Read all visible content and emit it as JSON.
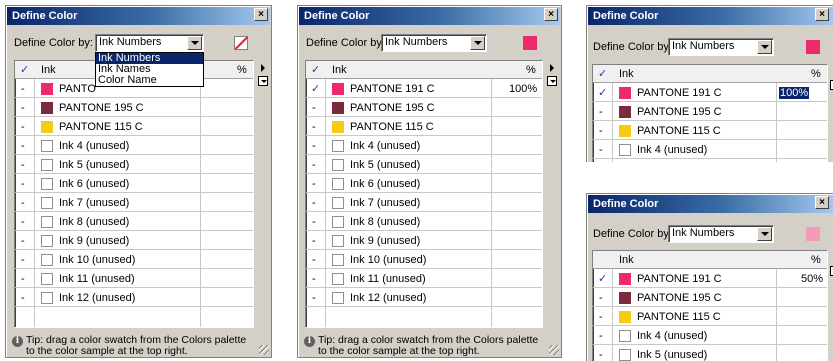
{
  "title": "Define Color",
  "close_glyph": "×",
  "define_label": "Define Color by:",
  "mode_value": "Ink Numbers",
  "dropdown_options": [
    "Ink Numbers",
    "Ink Names",
    "Color Name"
  ],
  "col_ink": "Ink",
  "col_pct": "%",
  "check_glyph": "✓",
  "dash": "-",
  "tip_line1": "Tip: drag a color swatch  from the Colors palette",
  "tip_line2": "to the color sample at the top right.",
  "info_glyph": "i",
  "inks": [
    {
      "name": "PANTONE 191 C",
      "color": "#ec2a6c"
    },
    {
      "name": "PANTONE 195 C",
      "color": "#7a2a3a"
    },
    {
      "name": "PANTONE 115 C",
      "color": "#f7cc10"
    },
    {
      "name": "Ink 4 (unused)",
      "color": "#ffffff"
    },
    {
      "name": "Ink 5 (unused)",
      "color": "#ffffff"
    },
    {
      "name": "Ink 6 (unused)",
      "color": "#ffffff"
    },
    {
      "name": "Ink 7 (unused)",
      "color": "#ffffff"
    },
    {
      "name": "Ink 8 (unused)",
      "color": "#ffffff"
    },
    {
      "name": "Ink 9 (unused)",
      "color": "#ffffff"
    },
    {
      "name": "Ink 10 (unused)",
      "color": "#ffffff"
    },
    {
      "name": "Ink 11 (unused)",
      "color": "#ffffff"
    },
    {
      "name": "Ink 12 (unused)",
      "color": "#ffffff"
    }
  ],
  "ink1_truncated": "PANTO",
  "pct_100": "100%",
  "pct_50": "50%",
  "sample_colors": {
    "full": "#ec2a6c",
    "half": "#f49bb9"
  }
}
